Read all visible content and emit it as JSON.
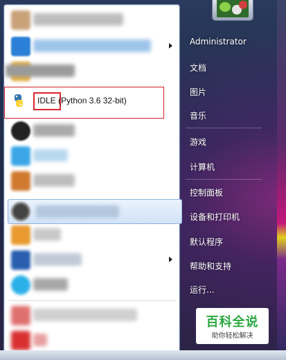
{
  "start_menu": {
    "highlighted_program": {
      "name": "IDLE",
      "detail": "(Python 3.6 32-bit)"
    },
    "right_items": [
      {
        "label": "Administrator",
        "icon": "user"
      },
      {
        "label": "文档",
        "icon": "documents"
      },
      {
        "label": "图片",
        "icon": "pictures"
      },
      {
        "label": "音乐",
        "icon": "music"
      },
      {
        "label": "游戏",
        "icon": "games"
      },
      {
        "label": "计算机",
        "icon": "computer"
      },
      {
        "label": "控制面板",
        "icon": "control-panel"
      },
      {
        "label": "设备和打印机",
        "icon": "devices-printers"
      },
      {
        "label": "默认程序",
        "icon": "default-programs"
      },
      {
        "label": "帮助和支持",
        "icon": "help-support"
      },
      {
        "label": "运行...",
        "icon": "run"
      }
    ]
  },
  "watermark": {
    "title": "百科全说",
    "subtitle": "助你轻松解决"
  },
  "colors": {
    "highlight_border": "#d0202a",
    "watermark_green": "#2aa840",
    "selected_row": "#d2e3f8"
  }
}
